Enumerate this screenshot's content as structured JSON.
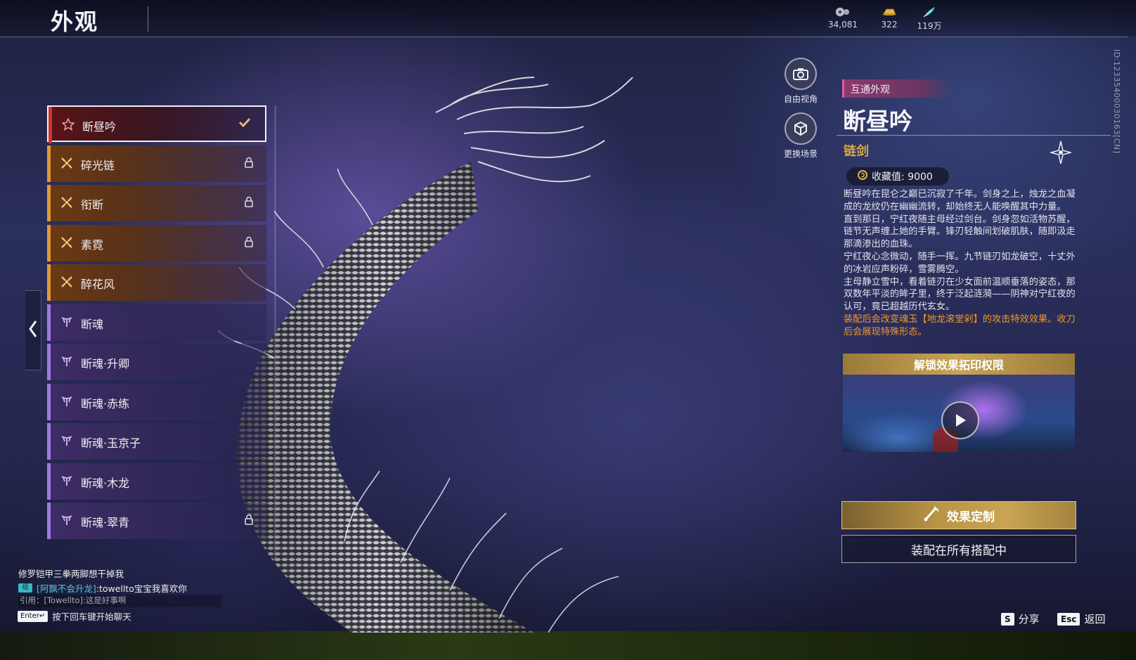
{
  "header": {
    "title": "外观"
  },
  "currencies": [
    {
      "icon": "gear-coin-icon",
      "value": "34,081"
    },
    {
      "icon": "gold-ingot-icon",
      "value": "322"
    },
    {
      "icon": "jade-feather-icon",
      "value": "119万"
    }
  ],
  "side_id": "ID:12335400030163[CN]",
  "list": {
    "items": [
      {
        "label": "断昼吟",
        "rarity": "red",
        "icon": "star-icon",
        "selected": true,
        "locked": false
      },
      {
        "label": "碎光链",
        "rarity": "orange",
        "icon": "rune-icon",
        "selected": false,
        "locked": true
      },
      {
        "label": "衔断",
        "rarity": "orange",
        "icon": "rune-icon",
        "selected": false,
        "locked": true
      },
      {
        "label": "素霓",
        "rarity": "orange",
        "icon": "rune-icon",
        "selected": false,
        "locked": true
      },
      {
        "label": "醉花风",
        "rarity": "orange",
        "icon": "rune-icon",
        "selected": false,
        "locked": false
      },
      {
        "label": "断魂",
        "rarity": "purple",
        "icon": "trident-icon",
        "selected": false,
        "locked": false
      },
      {
        "label": "断魂·升卿",
        "rarity": "purple",
        "icon": "trident-icon",
        "selected": false,
        "locked": false
      },
      {
        "label": "断魂·赤练",
        "rarity": "purple",
        "icon": "trident-icon",
        "selected": false,
        "locked": false
      },
      {
        "label": "断魂·玉京子",
        "rarity": "purple",
        "icon": "trident-icon",
        "selected": false,
        "locked": false
      },
      {
        "label": "断魂·木龙",
        "rarity": "purple",
        "icon": "trident-icon",
        "selected": false,
        "locked": false
      },
      {
        "label": "断魂·翠青",
        "rarity": "purple",
        "icon": "trident-icon",
        "selected": false,
        "locked": true
      }
    ]
  },
  "chat": {
    "line1": "修罗铠甲三拳两脚想干掉我",
    "tag": "组",
    "name": "[阿飘不会升龙]",
    "message": ":towellto宝宝我喜欢你",
    "quote": "引用：[Towellto]:这是好事啊",
    "enter_key": "Enter↵",
    "enter_hint": "按下回车键开始聊天"
  },
  "camera": {
    "free_view": "自由视角",
    "change_scene": "更换场景"
  },
  "detail": {
    "tag": "互通外观",
    "name": "断昼吟",
    "type": "链剑",
    "collect_label": "收藏值: 9000",
    "desc": [
      "断昼吟在昆仑之巅已沉寂了千年。剑身之上，烛龙之血凝成的龙纹仍在幽幽流转，却始终无人能唤醒其中力量。",
      "直到那日，宁红夜随主母经过剑台。剑身忽如活物苏醒，链节无声缠上她的手臂。锋刃轻触间划破肌肤，随即汲走那滴渗出的血珠。",
      "宁红夜心念微动，随手一挥。九节链刃如龙破空，十丈外的冰岩应声粉碎，雪雾腾空。",
      "主母静立雪中，看着链刃在少女面前温顺垂落的姿态，那双数年平淡的眸子里，终于泛起涟漪——阴神对宁红夜的认可，竟已超越历代玄女。"
    ],
    "effect_note": "装配后会改变魂玉【地龙滚堂剁】的攻击特效效果。收刀后会展现特殊形态。",
    "unlock_title": "解锁效果拓印权限",
    "custom_button": "效果定制",
    "equip_button": "装配在所有搭配中"
  },
  "hints": {
    "share_key": "S",
    "share_label": "分享",
    "back_key": "Esc",
    "back_label": "返回"
  },
  "colors": {
    "red": "#d0342c",
    "orange": "#e09a3a",
    "purple": "#a07ae0",
    "gold": "#c9a454",
    "type_gold": "#d9a846",
    "effect_orange": "#f0962a"
  }
}
